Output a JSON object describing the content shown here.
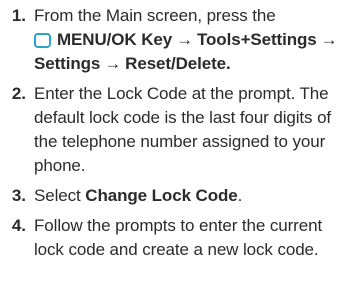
{
  "steps": [
    {
      "number": "1.",
      "text_start": "From the Main screen, press the",
      "key_icon": "menu-ok-key-icon",
      "nav_path": [
        "MENU/OK Key",
        "Tools+Settings",
        "Settings",
        "Reset/Delete"
      ],
      "arrow": "→",
      "end": "."
    },
    {
      "number": "2.",
      "text": "Enter the Lock Code at the prompt. The default lock code is the last four digits of the telephone number assigned to your phone."
    },
    {
      "number": "3.",
      "text_start": "Select ",
      "bold": "Change Lock Code",
      "end": "."
    },
    {
      "number": "4.",
      "text": "Follow the prompts to enter the current lock code and create a new lock code."
    }
  ],
  "colors": {
    "key_icon_border": "#2aa3c9",
    "text": "#2b2b2b"
  }
}
